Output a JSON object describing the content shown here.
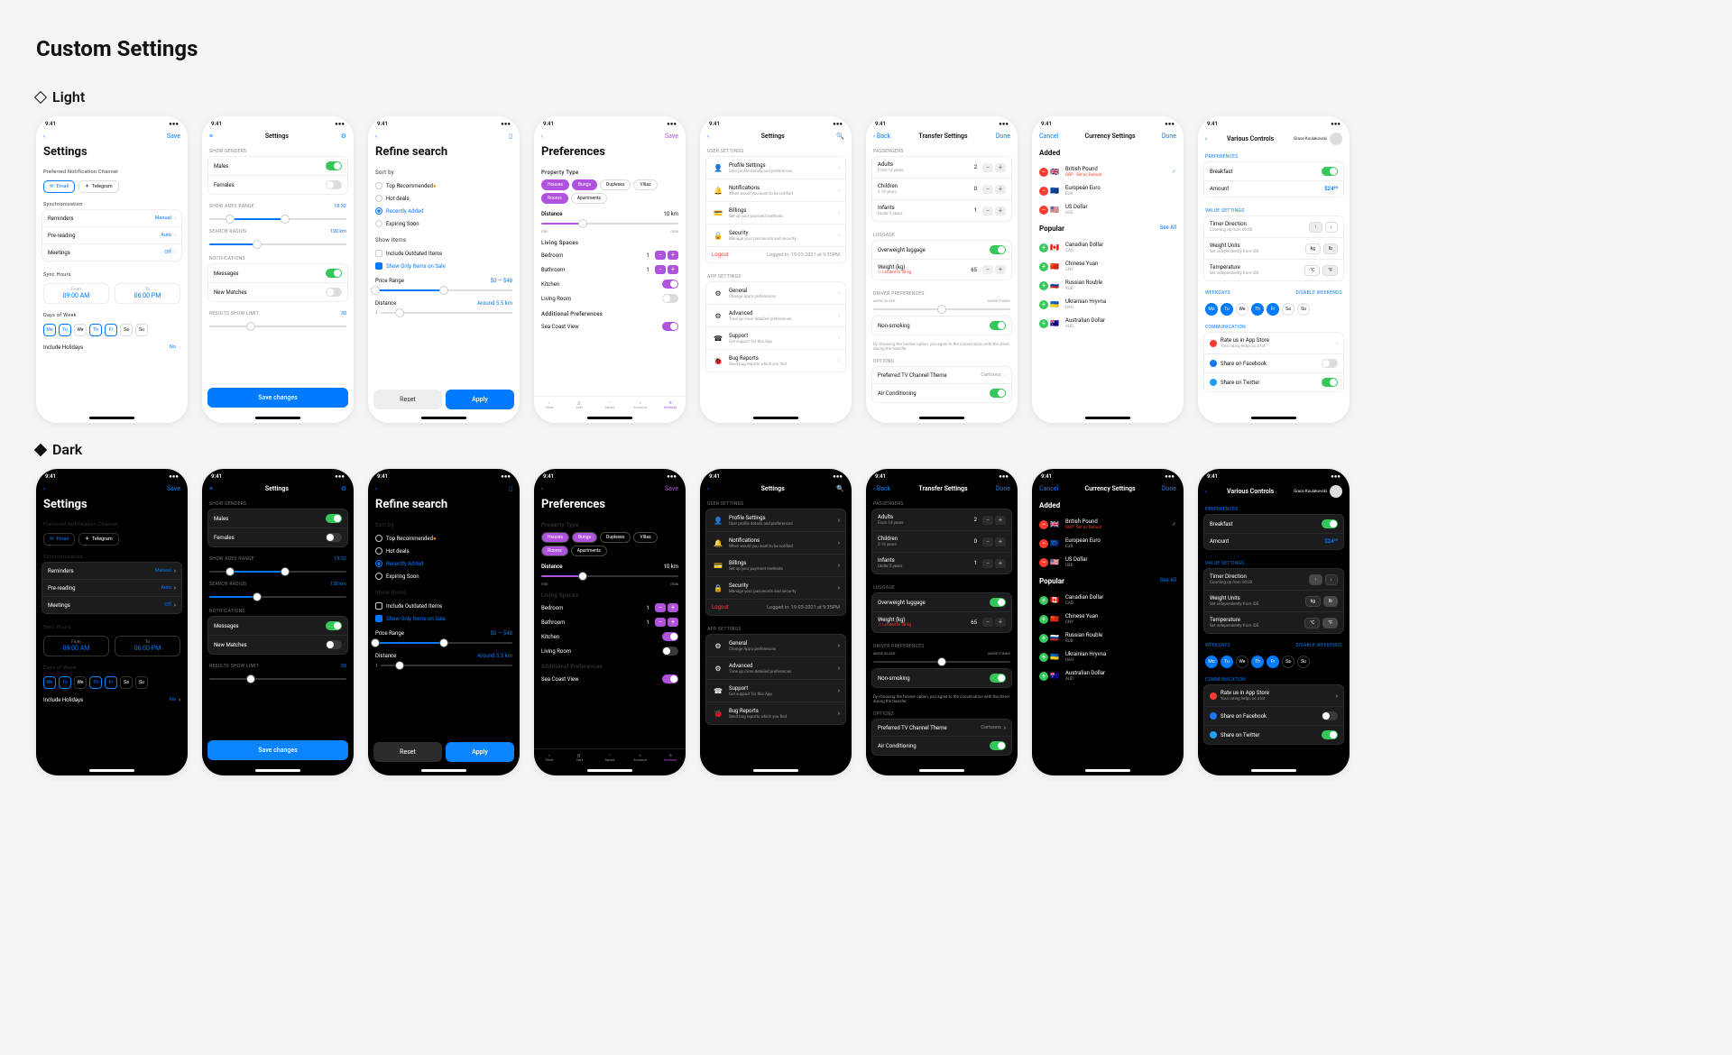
{
  "title": "Custom Settings",
  "themes": {
    "light": "Light",
    "dark": "Dark"
  },
  "status_time": "9:41",
  "s1": {
    "nav_save": "Save",
    "heading": "Settings",
    "notif_channel": "Preferred Notification Channel",
    "email": "Email",
    "telegram": "Telegram",
    "sync": "Synchronization",
    "reminders": "Reminders",
    "reminders_v": "Manual",
    "prereading": "Pre-reading",
    "prereading_v": "Auto",
    "meetings": "Meetings",
    "meetings_v": "Off",
    "sync_hours": "Sync Hours",
    "from": "From",
    "from_v": "09:00 AM",
    "to": "To",
    "to_v": "06:00 PM",
    "dow": "Days of Week",
    "days": [
      "Mo",
      "Tu",
      "We",
      "Th",
      "Fr",
      "Sa",
      "Su"
    ],
    "holidays": "Include Holidays",
    "holidays_v": "No"
  },
  "s2": {
    "title": "Settings",
    "genders": "SHOW GENDERS",
    "males": "Males",
    "females": "Females",
    "ages": "SHOW AGES RANGE",
    "ages_v": "18-32",
    "radius": "SEARCH RADIUS",
    "radius_v": "120 km",
    "notif": "NOTIFICATIONS",
    "messages": "Messages",
    "matches": "New Matches",
    "limit": "RESULTS SHOW LIMIT",
    "limit_v": "30",
    "save": "Save changes"
  },
  "s3": {
    "heading": "Refine search",
    "sortby": "Sort by",
    "top": "Top Recommended",
    "hot": "Hot deals",
    "recent": "Recently Added",
    "expiring": "Expiring Soon",
    "showitems": "Show Items",
    "outdated": "Include Outdated Items",
    "onsale": "Show Only Items on Sale",
    "price": "Price Range",
    "price_v": "$0 — $48",
    "dist": "Distance",
    "dist_v": "Around 5.5 km",
    "reset": "Reset",
    "apply": "Apply"
  },
  "s4": {
    "nav_save": "Save",
    "heading": "Preferences",
    "ptype": "Property Type",
    "chips": [
      "Houses",
      "Bungs",
      "Duplexes",
      "Villas",
      "Rooms",
      "Apartments"
    ],
    "dist": "Distance",
    "dist_v": "10 km",
    "min": "min",
    "max": "max",
    "spaces": "Living Spaces",
    "bedroom": "Bedroom",
    "bathroom": "Bathroom",
    "kitchen": "Kitchen",
    "living": "Living Room",
    "addpref": "Additional Preferences",
    "coast": "Sea Coast View",
    "tabs": [
      "Feed",
      "Cart",
      "Saved",
      "Account",
      "Settings"
    ]
  },
  "s5": {
    "title": "Settings",
    "user": "USER SETTINGS",
    "profile": "Profile Settings",
    "profile_s": "User profile details and preferences",
    "notif": "Notifications",
    "notif_s": "When would you want to be notified",
    "billing": "Billings",
    "billing_s": "Set up your payment methods",
    "security": "Security",
    "security_s": "Manage your passwords and security",
    "logout": "Logout",
    "logged": "Logged in: 19-03-2021 at 9:35PM",
    "app": "APP SETTINGS",
    "general": "General",
    "general_s": "Change App's preferences",
    "advanced": "Advanced",
    "advanced_s": "Tune up more detailed preferences",
    "support": "Support",
    "support_s": "Get support for this App",
    "bugs": "Bug Reports",
    "bugs_s": "Send bug reports which you find"
  },
  "s6": {
    "back": "Back",
    "title": "Transfer Settings",
    "done": "Done",
    "pass": "PASSENGERS",
    "adults": "Adults",
    "adults_s": "From 14 years",
    "adults_v": "2",
    "children": "Children",
    "children_s": "2-14 years",
    "children_v": "0",
    "infants": "Infants",
    "infants_s": "Under 2 years",
    "infants_v": "1",
    "lug": "LUGGAGE",
    "over": "Overweight luggage",
    "weight": "Weight (kg)",
    "weight_v": "65",
    "weight_w": "⚠ Limited to 58 kg",
    "drv": "DRIVER PREFERENCES",
    "silent": "MORE SILENT",
    "funny": "MORE FUNNY",
    "nonsmoke": "Non-smoking",
    "hint": "By choosing the funnier option, you agree to the conversation with the driver during the transfer.",
    "opt": "OPTIONS",
    "tv": "Preferred TV Channel Theme",
    "tv_v": "Cartoons",
    "ac": "Air Conditioning"
  },
  "s7": {
    "cancel": "Cancel",
    "title": "Currency Settings",
    "done": "Done",
    "added": "Added",
    "popular": "Popular",
    "seeall": "See All",
    "gbp": "British Pound",
    "gbp_s": "GBP · Set as Default",
    "eur": "European Euro",
    "eur_s": "EUR",
    "usd": "US Dollar",
    "usd_s": "USD",
    "cad": "Canadian Dollar",
    "cad_s": "CAD",
    "cny": "Chinese Yuan",
    "cny_s": "CNY",
    "rub": "Russian Rouble",
    "rub_s": "RUB",
    "uah": "Ukrainian Hryvna",
    "uah_s": "UAH",
    "aud": "Australian Dollar",
    "aud_s": "AUD"
  },
  "s8": {
    "title": "Various Controls",
    "user": "Grace Koulakovski",
    "pref": "PREFERENCES",
    "breakfast": "Breakfast",
    "amount": "Amount",
    "amount_v": "$24⁹⁹",
    "vals": "VALUE SETTINGS",
    "timer": "Timer Direction",
    "timer_s": "Counting up from 00:00",
    "wunits": "Weight Units",
    "wunits_s": "Set independently from iOS",
    "temp": "Temperature",
    "temp_s": "Set independently from iOS",
    "kg": "kg",
    "lb": "lb",
    "c": "°C",
    "f": "°F",
    "up": "↑",
    "dn": "↓",
    "wk": "WEEKDAYS",
    "disable": "DISABLE WEEKENDS",
    "days": [
      "Mo",
      "Tu",
      "We",
      "Th",
      "Fr",
      "Sa",
      "Su"
    ],
    "comm": "COMMUNICATION",
    "rate": "Rate us in App Store",
    "rate_s": "Your rating helps us a lot",
    "fb": "Share on Facebook",
    "tw": "Share on Twitter"
  }
}
